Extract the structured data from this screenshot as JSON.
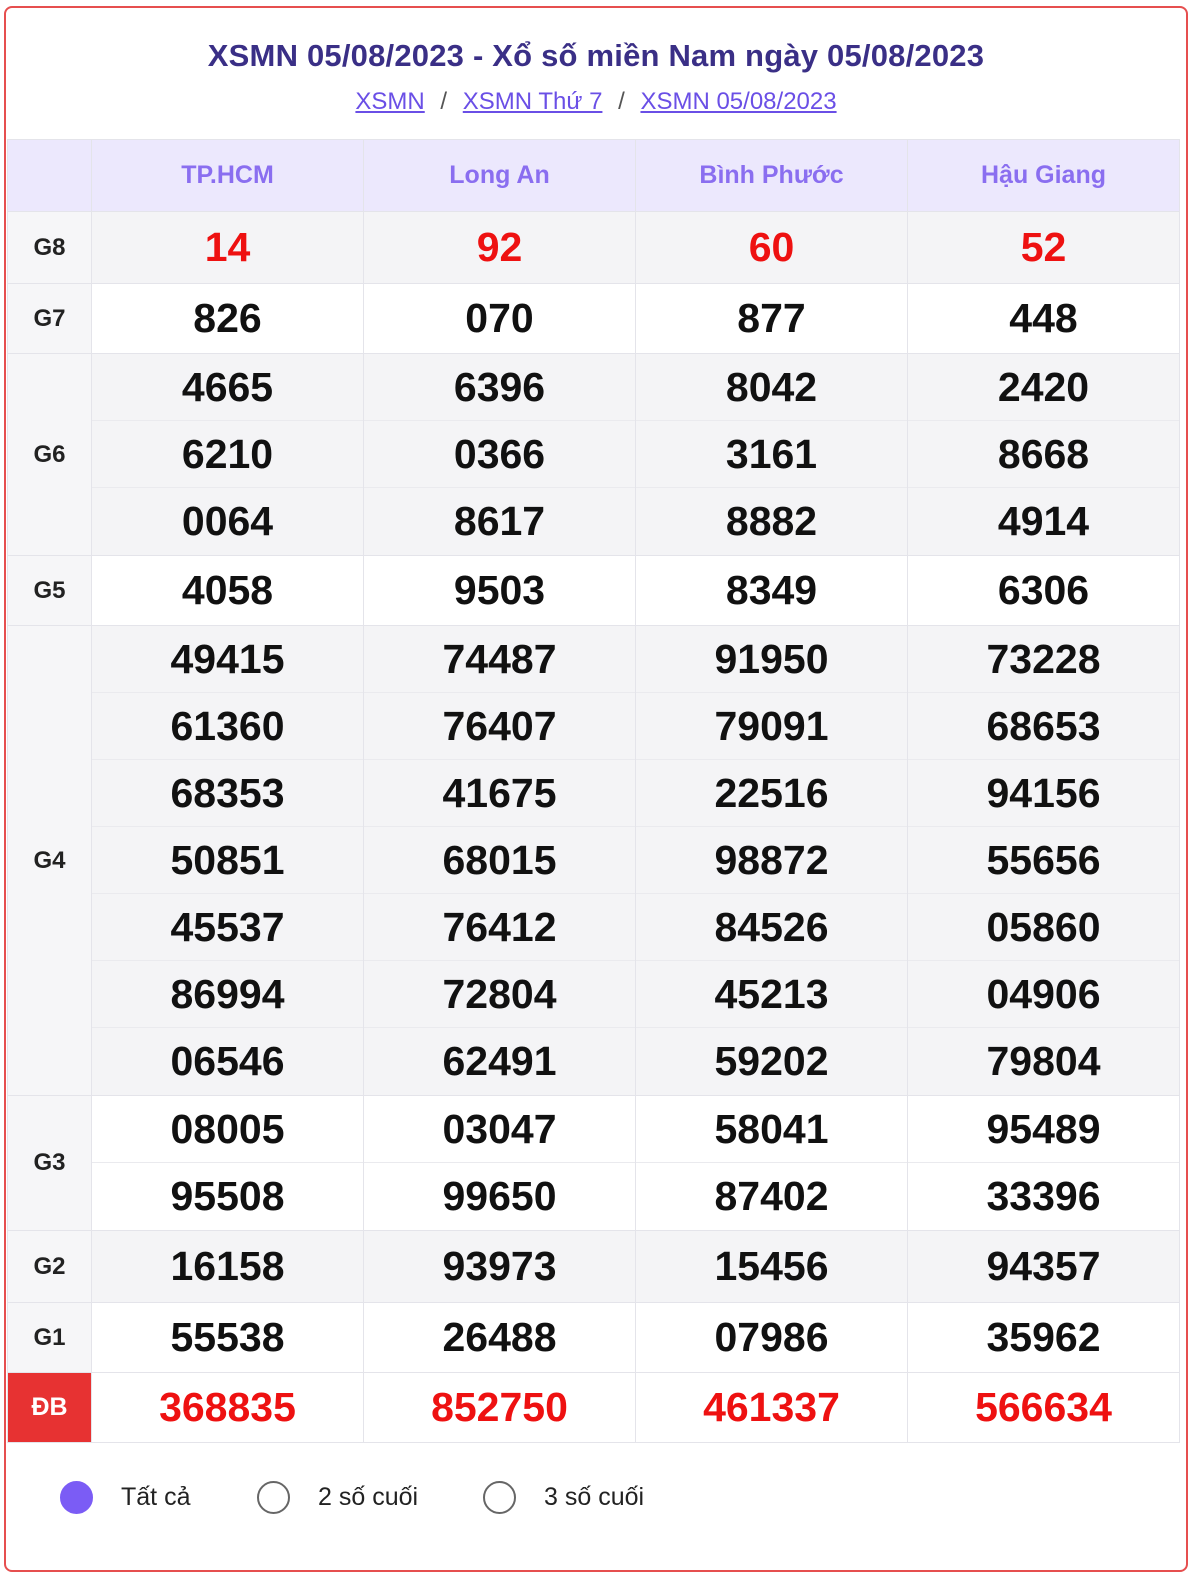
{
  "header": {
    "title": "XSMN 05/08/2023 - Xổ số miền Nam ngày 05/08/2023",
    "breadcrumb": [
      "XSMN",
      "XSMN Thứ 7",
      "XSMN 05/08/2023"
    ],
    "separator": "/"
  },
  "provinces": [
    "TP.HCM",
    "Long An",
    "Bình Phước",
    "Hậu Giang"
  ],
  "prizes": {
    "G8": {
      "label": "G8",
      "values": [
        [
          "14"
        ],
        [
          "92"
        ],
        [
          "60"
        ],
        [
          "52"
        ]
      ]
    },
    "G7": {
      "label": "G7",
      "values": [
        [
          "826"
        ],
        [
          "070"
        ],
        [
          "877"
        ],
        [
          "448"
        ]
      ]
    },
    "G6": {
      "label": "G6",
      "values": [
        [
          "4665",
          "6210",
          "0064"
        ],
        [
          "6396",
          "0366",
          "8617"
        ],
        [
          "8042",
          "3161",
          "8882"
        ],
        [
          "2420",
          "8668",
          "4914"
        ]
      ]
    },
    "G5": {
      "label": "G5",
      "values": [
        [
          "4058"
        ],
        [
          "9503"
        ],
        [
          "8349"
        ],
        [
          "6306"
        ]
      ]
    },
    "G4": {
      "label": "G4",
      "values": [
        [
          "49415",
          "61360",
          "68353",
          "50851",
          "45537",
          "86994",
          "06546"
        ],
        [
          "74487",
          "76407",
          "41675",
          "68015",
          "76412",
          "72804",
          "62491"
        ],
        [
          "91950",
          "79091",
          "22516",
          "98872",
          "84526",
          "45213",
          "59202"
        ],
        [
          "73228",
          "68653",
          "94156",
          "55656",
          "05860",
          "04906",
          "79804"
        ]
      ]
    },
    "G3": {
      "label": "G3",
      "values": [
        [
          "08005",
          "95508"
        ],
        [
          "03047",
          "99650"
        ],
        [
          "58041",
          "87402"
        ],
        [
          "95489",
          "33396"
        ]
      ]
    },
    "G2": {
      "label": "G2",
      "values": [
        [
          "16158"
        ],
        [
          "93973"
        ],
        [
          "15456"
        ],
        [
          "94357"
        ]
      ]
    },
    "G1": {
      "label": "G1",
      "values": [
        [
          "55538"
        ],
        [
          "26488"
        ],
        [
          "07986"
        ],
        [
          "35962"
        ]
      ]
    },
    "DB": {
      "label": "ĐB",
      "values": [
        [
          "368835"
        ],
        [
          "852750"
        ],
        [
          "461337"
        ],
        [
          "566634"
        ]
      ]
    }
  },
  "filter": {
    "options": [
      "Tất cả",
      "2 số cuối",
      "3 số cuối"
    ],
    "selected_index": 0,
    "selected_color": "#7b5cf5"
  }
}
